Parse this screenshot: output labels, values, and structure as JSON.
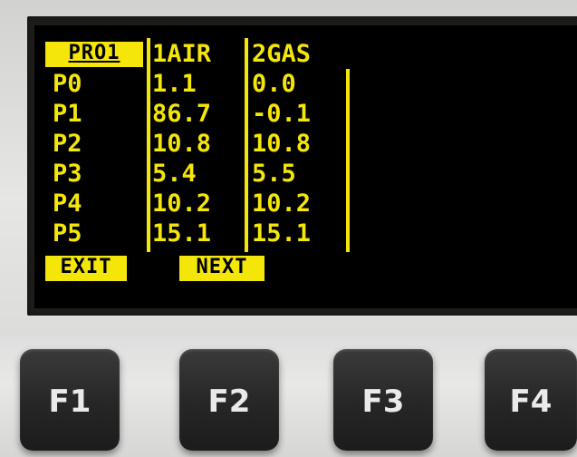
{
  "header": {
    "program": "PRO1",
    "col1": "1AIR",
    "col2": "2GAS"
  },
  "rows": [
    {
      "label": "P0",
      "air": "1.1",
      "gas": "0.0"
    },
    {
      "label": "P1",
      "air": "86.7",
      "gas": "-0.1"
    },
    {
      "label": "P2",
      "air": "10.8",
      "gas": "10.8"
    },
    {
      "label": "P3",
      "air": "5.4",
      "gas": "5.5"
    },
    {
      "label": "P4",
      "air": "10.2",
      "gas": "10.2"
    },
    {
      "label": "P5",
      "air": "15.1",
      "gas": "15.1"
    }
  ],
  "softkeys": {
    "exit": "EXIT",
    "next": "NEXT"
  },
  "buttons": [
    "F1",
    "F2",
    "F3",
    "F4"
  ],
  "colors": {
    "display_fg": "#f5e60a",
    "display_bg": "#000000",
    "key": "#262626"
  }
}
